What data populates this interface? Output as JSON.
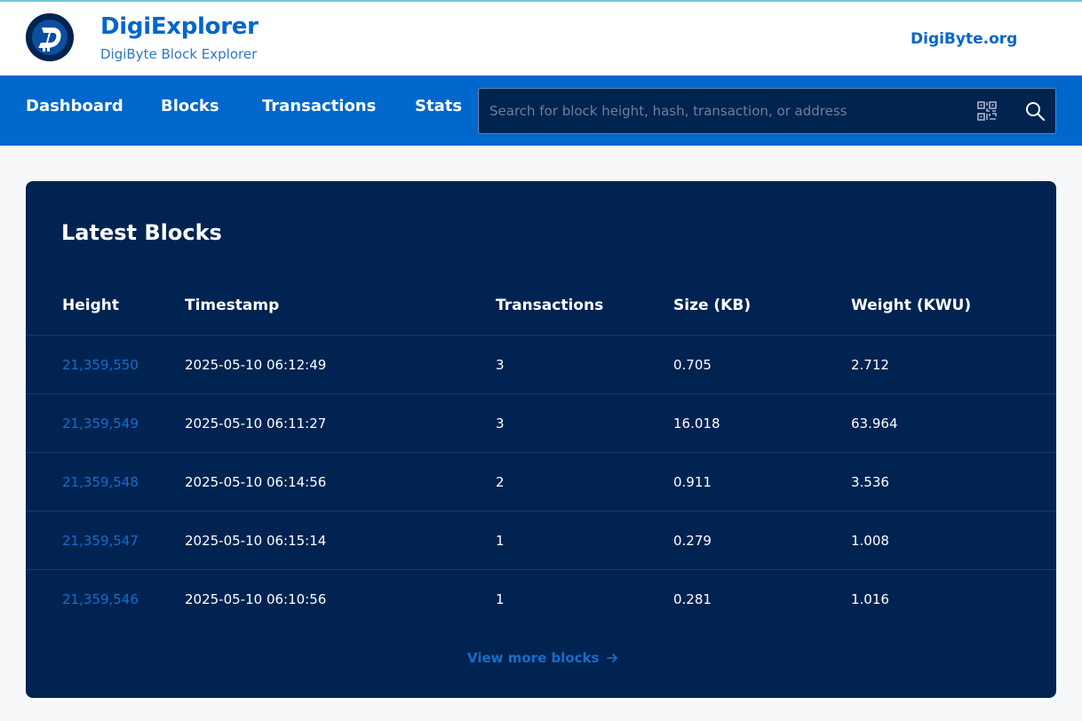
{
  "brand": {
    "title": "DigiExplorer",
    "subtitle": "DigiByte Block Explorer",
    "site_link": "DigiByte.org",
    "accent": "#0066cc"
  },
  "nav": {
    "items": [
      "Dashboard",
      "Blocks",
      "Transactions",
      "Stats"
    ],
    "search_placeholder": "Search for block height, hash, transaction, or address",
    "search_value": "",
    "icons": [
      "qr-code-icon",
      "search-icon"
    ]
  },
  "latest_blocks": {
    "title": "Latest Blocks",
    "columns": [
      "Height",
      "Timestamp",
      "Transactions",
      "Size (KB)",
      "Weight (KWU)"
    ],
    "rows": [
      {
        "height": "21,359,550",
        "timestamp": "2025-05-10 06:12:49",
        "transactions": "3",
        "size": "0.705",
        "weight": "2.712"
      },
      {
        "height": "21,359,549",
        "timestamp": "2025-05-10 06:11:27",
        "transactions": "3",
        "size": "16.018",
        "weight": "63.964"
      },
      {
        "height": "21,359,548",
        "timestamp": "2025-05-10 06:14:56",
        "transactions": "2",
        "size": "0.911",
        "weight": "3.536"
      },
      {
        "height": "21,359,547",
        "timestamp": "2025-05-10 06:15:14",
        "transactions": "1",
        "size": "0.279",
        "weight": "1.008"
      },
      {
        "height": "21,359,546",
        "timestamp": "2025-05-10 06:10:56",
        "transactions": "1",
        "size": "0.281",
        "weight": "1.016"
      }
    ],
    "view_more": "View more blocks"
  },
  "colors": {
    "nav_bg": "#0067cc",
    "panel_bg": "#002352",
    "link": "#1b6cc6"
  }
}
